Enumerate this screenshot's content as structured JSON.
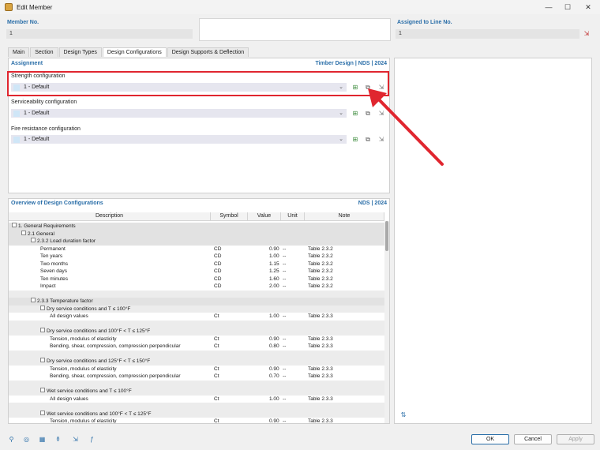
{
  "window": {
    "title": "Edit Member",
    "minimize": "—",
    "maximize": "☐",
    "close": "✕"
  },
  "member": {
    "label": "Member No.",
    "value": "1"
  },
  "assigned": {
    "label": "Assigned to Line No.",
    "value": "1"
  },
  "tabs": [
    "Main",
    "Section",
    "Design Types",
    "Design Configurations",
    "Design Supports & Deflection"
  ],
  "assignment": {
    "title": "Assignment",
    "standard": "Timber Design | NDS | 2024",
    "strength": {
      "label": "Strength configuration",
      "value": "1 - Default"
    },
    "serviceability": {
      "label": "Serviceability configuration",
      "value": "1 - Default"
    },
    "fire": {
      "label": "Fire resistance configuration",
      "value": "1 - Default"
    }
  },
  "overview": {
    "title": "Overview of Design Configurations",
    "standard": "NDS | 2024",
    "columns": [
      "Description",
      "Symbol",
      "Value",
      "Unit",
      "Note"
    ],
    "rows": [
      {
        "d": "1. General Requirements",
        "lvl": 0,
        "t": "h0"
      },
      {
        "d": "2.1 General",
        "lvl": 1,
        "t": "h1"
      },
      {
        "d": "2.3.2 Load duration factor",
        "lvl": 2,
        "t": "h2"
      },
      {
        "d": "Permanent",
        "lvl": 3,
        "s": "CD",
        "v": "0.90",
        "u": "--",
        "n": "Table 2.3.2"
      },
      {
        "d": "Ten years",
        "lvl": 3,
        "s": "CD",
        "v": "1.00",
        "u": "--",
        "n": "Table 2.3.2"
      },
      {
        "d": "Two months",
        "lvl": 3,
        "s": "CD",
        "v": "1.15",
        "u": "--",
        "n": "Table 2.3.2"
      },
      {
        "d": "Seven days",
        "lvl": 3,
        "s": "CD",
        "v": "1.25",
        "u": "--",
        "n": "Table 2.3.2"
      },
      {
        "d": "Ten minutes",
        "lvl": 3,
        "s": "CD",
        "v": "1.60",
        "u": "--",
        "n": "Table 2.3.2"
      },
      {
        "d": "Impact",
        "lvl": 3,
        "s": "CD",
        "v": "2.00",
        "u": "--",
        "n": "Table 2.3.2"
      },
      {
        "d": "",
        "t": "blank"
      },
      {
        "d": "2.3.3 Temperature factor",
        "lvl": 2,
        "t": "h2"
      },
      {
        "d": "Dry service conditions and T ≤ 100°F",
        "lvl": 3,
        "t": "h3"
      },
      {
        "d": "All design values",
        "lvl": 4,
        "s": "Ct",
        "v": "1.00",
        "u": "--",
        "n": "Table 2.3.3"
      },
      {
        "d": "",
        "t": "blank"
      },
      {
        "d": "Dry service conditions and 100°F < T ≤ 125°F",
        "lvl": 3,
        "t": "h3"
      },
      {
        "d": "Tension, modulus of elasticity",
        "lvl": 4,
        "s": "Ct",
        "v": "0.90",
        "u": "--",
        "n": "Table 2.3.3"
      },
      {
        "d": "Bending, shear, compression, compression perpendicular",
        "lvl": 4,
        "s": "Ct",
        "v": "0.80",
        "u": "--",
        "n": "Table 2.3.3"
      },
      {
        "d": "",
        "t": "blank"
      },
      {
        "d": "Dry service conditions and 125°F < T ≤ 150°F",
        "lvl": 3,
        "t": "h3"
      },
      {
        "d": "Tension, modulus of elasticity",
        "lvl": 4,
        "s": "Ct",
        "v": "0.90",
        "u": "--",
        "n": "Table 2.3.3"
      },
      {
        "d": "Bending, shear, compression, compression perpendicular",
        "lvl": 4,
        "s": "Ct",
        "v": "0.70",
        "u": "--",
        "n": "Table 2.3.3"
      },
      {
        "d": "",
        "t": "blank"
      },
      {
        "d": "Wet service conditions and T ≤ 100°F",
        "lvl": 3,
        "t": "h3"
      },
      {
        "d": "All design values",
        "lvl": 4,
        "s": "Ct",
        "v": "1.00",
        "u": "--",
        "n": "Table 2.3.3"
      },
      {
        "d": "",
        "t": "blank"
      },
      {
        "d": "Wet service conditions and 100°F < T ≤ 125°F",
        "lvl": 3,
        "t": "h3"
      },
      {
        "d": "Tension, modulus of elasticity",
        "lvl": 4,
        "s": "Ct",
        "v": "0.90",
        "u": "--",
        "n": "Table 2.3.3"
      }
    ]
  },
  "buttons": {
    "ok": "OK",
    "cancel": "Cancel",
    "apply": "Apply"
  },
  "colors": {
    "accent": "#2a6ea8",
    "highlight": "#e0262f"
  }
}
